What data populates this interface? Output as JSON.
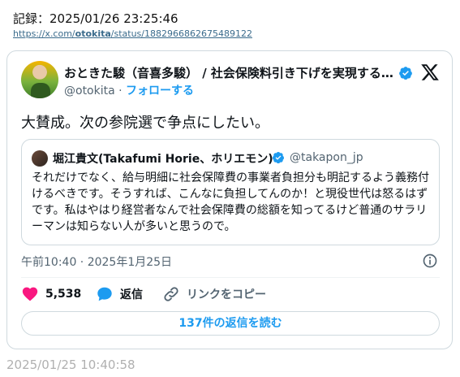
{
  "record": {
    "label": "記録：2025/01/26 23:25:46",
    "url_prefix": "https://x.com/",
    "url_user": "otokita",
    "url_suffix": "/status/1882966862675489122"
  },
  "tweet": {
    "author_name": "おときた駿（音喜多駿） / 社会保険料引き下げを実現する…",
    "handle": "@otokita",
    "separator": " · ",
    "follow_label": "フォローする",
    "text": "大賛成。次の参院選で争点にしたい。",
    "timestamp": "午前10:40 · 2025年1月25日",
    "likes": "5,538",
    "reply_label": "返信",
    "copy_link_label": "リンクをコピー",
    "read_replies_label": "137件の返信を読む"
  },
  "quote": {
    "author_name": "堀江貴文(Takafumi Horie、ホリエモン)",
    "handle": "@takapon_jp",
    "text": "それだけでなく、給与明細に社会保障費の事業者負担分も明記するよう義務付けるべきです。そうすれば、こんなに負担してんのか！と現役世代は怒るはずです。私はやはり経営者なんで社会保障費の総額を知ってるけど普通のサラリーマンは知らない人が多いと思うので。"
  },
  "footer": {
    "date": "2025/01/25 10:40:58"
  },
  "colors": {
    "accent": "#1d9bf0",
    "like": "#f91880",
    "muted": "#536471",
    "border": "#cfd9de"
  },
  "icons": [
    "verified-badge-icon",
    "x-logo-icon",
    "info-icon",
    "heart-icon",
    "reply-bubble-icon",
    "link-icon"
  ]
}
